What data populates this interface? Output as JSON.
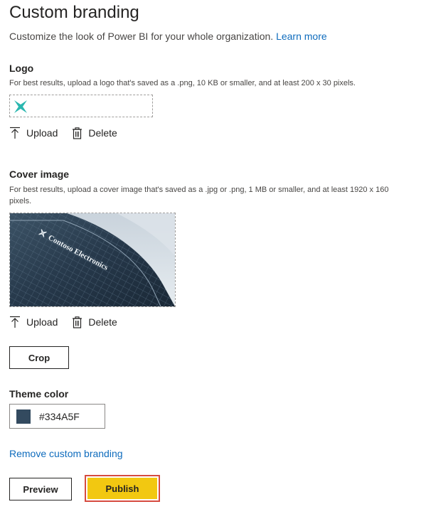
{
  "header": {
    "title": "Custom branding",
    "intro_text": "Customize the look of Power BI for your whole organization.",
    "learn_more": "Learn more"
  },
  "logo": {
    "heading": "Logo",
    "hint": "For best results, upload a logo that's saved as a .png, 10 KB or smaller, and at least 200 x 30 pixels.",
    "upload_label": "Upload",
    "delete_label": "Delete"
  },
  "cover": {
    "heading": "Cover image",
    "hint": "For best results, upload a cover image that's saved as a .jpg or .png, 1 MB or smaller, and at least 1920 x 160 pixels.",
    "image_text": "Contoso Electronics",
    "upload_label": "Upload",
    "delete_label": "Delete",
    "crop_label": "Crop"
  },
  "theme": {
    "heading": "Theme color",
    "value": "#334A5F",
    "swatch_color": "#334A5F"
  },
  "footer": {
    "remove_label": "Remove custom branding",
    "preview_label": "Preview",
    "publish_label": "Publish"
  },
  "colors": {
    "accent_link": "#0f6cbd",
    "publish_bg": "#f2c811",
    "highlight_border": "#d64b3f",
    "logo_icon": "#2ab7b0"
  },
  "icons": [
    "upload-icon",
    "trash-icon",
    "contoso-logo-icon"
  ]
}
